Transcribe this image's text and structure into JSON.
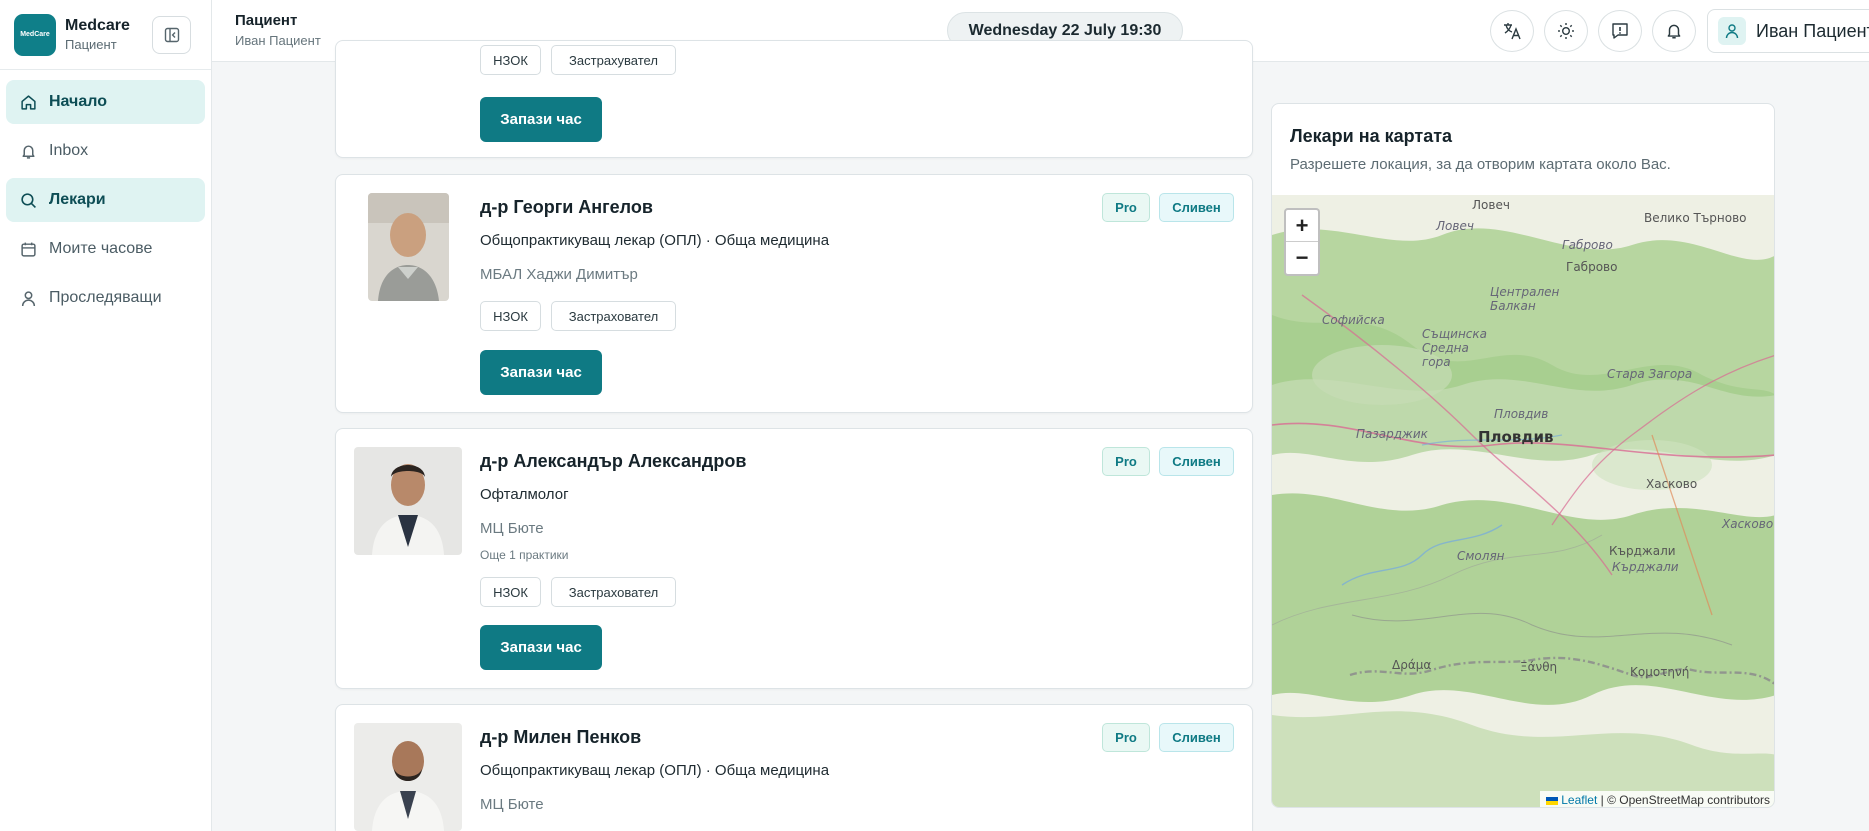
{
  "brand": {
    "name": "Medcare",
    "role": "Пациент",
    "logo_text": "MedCare"
  },
  "nav": [
    {
      "label": "Начало",
      "icon": "home-icon",
      "active": true
    },
    {
      "label": "Inbox",
      "icon": "bell-icon",
      "active": false
    },
    {
      "label": "Лекари",
      "icon": "search-icon",
      "active": true
    },
    {
      "label": "Моите часове",
      "icon": "calendar-icon",
      "active": false
    },
    {
      "label": "Проследяващи",
      "icon": "user-icon",
      "active": false
    }
  ],
  "header": {
    "title": "Пациент",
    "subtitle": "Иван Пациент",
    "datetime": "Wednesday 22 July 19:30",
    "user_name": "Иван Пациент"
  },
  "cards": [
    {
      "tags": [
        "НЗОК",
        "Застрахувател"
      ],
      "book_label": "Запази час"
    },
    {
      "name": "д-р Георги Ангелов",
      "specialty": "Общопрактикуващ лекар (ОПЛ) · Обща медицина",
      "clinic": "МБАЛ Хаджи Димитър",
      "tags": [
        "НЗОК",
        "Застраховател"
      ],
      "badges": [
        "Pro",
        "Сливен"
      ],
      "book_label": "Запази час"
    },
    {
      "name": "д-р Александър Александров",
      "specialty": "Офталмолог",
      "clinic": "МЦ Бюте",
      "more": "Още 1 практики",
      "tags": [
        "НЗОК",
        "Застраховател"
      ],
      "badges": [
        "Pro",
        "Сливен"
      ],
      "book_label": "Запази час"
    },
    {
      "name": "д-р Милен Пенков",
      "specialty": "Общопрактикуващ лекар (ОПЛ) · Обща медицина",
      "clinic": "МЦ Бюте",
      "badges": [
        "Pro",
        "Сливен"
      ]
    }
  ],
  "map": {
    "title": "Лекари на картата",
    "subtitle": "Разрешете локация, за да отворим картата около Вас.",
    "zoom_in": "+",
    "zoom_out": "−",
    "attribution_link": "Leaflet",
    "attribution_text": "| © OpenStreetMap contributors",
    "cities": [
      "Ловеч",
      "Велико Търново",
      "Ловеч",
      "Габрово",
      "Габрово",
      "Централен Балкан",
      "Софийска",
      "Същинска Средна гора",
      "Стара Загора",
      "Пловдив",
      "Пазарджик",
      "Пловдив",
      "Хасково",
      "Хасково",
      "Смолян",
      "Кърджали",
      "Кърджали",
      "Δράμα",
      "Ξάνθη",
      "Κομοτηνή"
    ]
  },
  "colors": {
    "accent": "#0f7a84",
    "active_bg": "#dff3f2"
  }
}
